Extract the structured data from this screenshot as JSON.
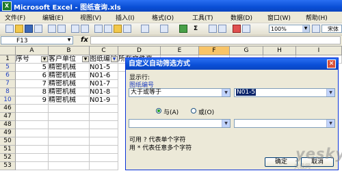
{
  "window": {
    "title": "Microsoft Excel - 图纸查询.xls"
  },
  "menu": [
    "文件(F)",
    "编辑(E)",
    "视图(V)",
    "插入(I)",
    "格式(O)",
    "工具(T)",
    "数据(D)",
    "窗口(W)",
    "帮助(H)"
  ],
  "toolbar": {
    "sum": "Σ",
    "zoom": "100%",
    "font": "宋体"
  },
  "formula_bar": {
    "name_box": "F13",
    "fx": "fx",
    "content": ""
  },
  "columns": [
    "A",
    "B",
    "C",
    "D",
    "E",
    "F",
    "G",
    "H",
    "I"
  ],
  "selected_column": "F",
  "header_row": {
    "row": "1",
    "a": "序号",
    "b": "客户单位",
    "c": "图纸编号",
    "d": "所在文件夹"
  },
  "rows": [
    {
      "num": "5",
      "a": "5",
      "b": "精密机械",
      "c": "N01-5"
    },
    {
      "num": "6",
      "a": "6",
      "b": "精密机械",
      "c": "N01-6"
    },
    {
      "num": "7",
      "a": "7",
      "b": "精密机械",
      "c": "N01-7"
    },
    {
      "num": "8",
      "a": "8",
      "b": "精密机械",
      "c": "N01-8"
    },
    {
      "num": "10",
      "a": "9",
      "b": "精密机械",
      "c": "N01-9"
    },
    {
      "num": "46"
    },
    {
      "num": "47"
    },
    {
      "num": "48"
    },
    {
      "num": "49"
    },
    {
      "num": "50"
    },
    {
      "num": "51"
    },
    {
      "num": "52"
    },
    {
      "num": "53"
    }
  ],
  "dialog": {
    "title": "自定义自动筛选方式",
    "show_rows": "显示行:",
    "field": "图纸编号",
    "operator1": "大于或等于",
    "value1": "N01-5",
    "and_label": "与(A)",
    "or_label": "或(O)",
    "operator2": "",
    "value2": "",
    "hint1": "可用 ? 代表单个字符",
    "hint2": "用 * 代表任意多个字符",
    "ok": "确定",
    "cancel": "取消"
  },
  "watermark": {
    "text": "yesky",
    "sub": "天极网"
  }
}
